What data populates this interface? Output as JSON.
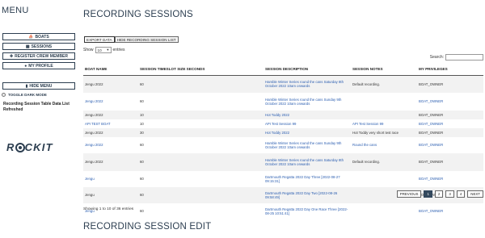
{
  "sidebar": {
    "menu_title": "MENU",
    "buttons": [
      {
        "label": "BOATS",
        "icon": "ship-icon",
        "glyph": "⛵"
      },
      {
        "label": "SESSIONS",
        "icon": "calendar-icon",
        "glyph": "▦"
      },
      {
        "label": "REGISTER CREW MEMBER",
        "icon": "add-user-icon",
        "glyph": "✚"
      },
      {
        "label": "MY PROFILE",
        "icon": "user-icon",
        "glyph": "●"
      }
    ],
    "hide_menu_label": "HIDE MENU",
    "hide_menu_glyph": "▮",
    "toggle_dark_mode_label": "TOGGLE DARK MODE",
    "status_message": "Recording Session Table Data List Refreshed",
    "logo_text_pre": "R",
    "logo_text_post": "CKIT"
  },
  "main": {
    "page_title": "RECORDING SESSIONS",
    "toolbar": {
      "export_label": "EXPORT DATA",
      "hide_list_label": "HIDE RECORDING SESSION LIST"
    },
    "show": {
      "prefix": "Show",
      "value": "10",
      "suffix": "entries"
    },
    "search": {
      "label": "Search:",
      "value": ""
    },
    "table": {
      "headers": [
        "BOAT NAME",
        "SESSION TIMESLOT SIZE SECONDS",
        "SESSION DESCRIPTION",
        "SESSION NOTES",
        "MY PRIVILEGES"
      ],
      "rows": [
        {
          "boat": "Jengu 2022",
          "size": "60",
          "desc": "Hamble Winter Series round the cans Saturday 8th October 2022 10am onwards",
          "notes": "Default recording.",
          "priv": "BOAT_OWNER"
        },
        {
          "boat": "Jengu 2022",
          "size": "60",
          "desc": "Hamble Winter Series round the cans Sunday 9th October 2022 10am onwards",
          "notes": "",
          "priv": "BOAT_OWNER"
        },
        {
          "boat": "Jengu 2022",
          "size": "10",
          "desc": "Hot Toddy 2022",
          "notes": "",
          "priv": "BOAT_OWNER"
        },
        {
          "boat": "API TEST BOAT",
          "size": "10",
          "desc": "API Test Session 99",
          "notes": "API Test Session 99",
          "priv": "BOAT_OWNER"
        },
        {
          "boat": "Jengu 2022",
          "size": "30",
          "desc": "Hot Toddy 2022",
          "notes": "Hot Toddy very short test race",
          "priv": "BOAT_OWNER"
        },
        {
          "boat": "Jengu 2022",
          "size": "60",
          "desc": "Hamble Winter Series round the cans Sunday 9th October 2022 10am onwards",
          "notes": "Round the cans",
          "priv": "BOAT_OWNER"
        },
        {
          "boat": "Jengu 2022",
          "size": "60",
          "desc": "Hamble Winter Series round the cans Saturday 8th October 2022 10am onwards",
          "notes": "Default recording.",
          "priv": "BOAT_OWNER"
        },
        {
          "boat": "Jengu",
          "size": "60",
          "desc": "Dartmouth Regatta 2022 Day Three [2022-08-27 09:15:31]",
          "notes": "",
          "priv": "BOAT_OWNER"
        },
        {
          "boat": "Jengu",
          "size": "60",
          "desc": "Dartmouth Regatta 2022 Day Two [2022-08-26 09:58:49]",
          "notes": "",
          "priv": "BOAT_OWNER"
        },
        {
          "boat": "Jengu",
          "size": "60",
          "desc": "Dartmouth Regatta 2022 Day One Race Three [2022-08-25 10:51:41]",
          "notes": "",
          "priv": "BOAT_OWNER"
        }
      ]
    },
    "info": "Showing 1 to 10 of 36 entries",
    "pager": [
      "PREVIOUS",
      "1",
      "2",
      "3",
      "4",
      "NEXT"
    ],
    "edit_title": "RECORDING SESSION EDIT"
  },
  "colors": {
    "primary": "#2c3e50",
    "link": "#2a5db0",
    "active_page": "#34495e"
  }
}
